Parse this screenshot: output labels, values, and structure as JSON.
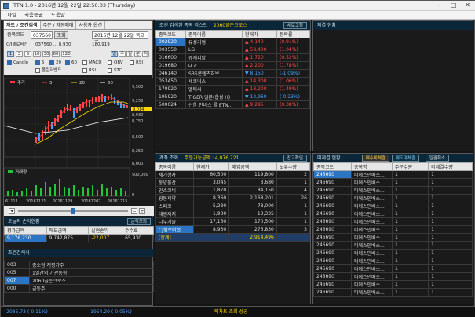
{
  "window": {
    "title": "TTN 1.0 - 2016년 12월 22일 22:50:03 (Thursday)"
  },
  "menu": [
    "파일",
    "키움증권",
    "도움말"
  ],
  "left": {
    "tabs": [
      "차트 / 조건검색",
      "주문 / 자동매매",
      "사용자 옵션"
    ],
    "code_label": "종목코드",
    "code_value": "037560",
    "search_btn": "조회",
    "date_value": "2016년 12월 22일 목요일",
    "info": {
      "name": "C/J헬로비전",
      "price": "037560 ... 8,930",
      "extra": "180,919"
    },
    "period_buttons": [
      "1",
      "3",
      "5",
      "10",
      "30",
      "60",
      "120"
    ],
    "period_right": [
      "일",
      "주",
      "월",
      "분",
      "틱"
    ],
    "indicators_row1": [
      "Candle",
      "5",
      "20",
      "60",
      "MACD",
      "OBV",
      "RSI"
    ],
    "indicators_row2": [
      "볼린저밴드",
      "RSI",
      "STC"
    ],
    "chart": {
      "legend": [
        "주가",
        "5",
        "20",
        "60"
      ],
      "price_labels": [
        "9,500",
        "9,250",
        "9,014",
        "8,930",
        "8,750",
        "8,500",
        "8,250",
        "8,000"
      ],
      "volume_label": "거래량",
      "volume_axis": [
        "500,000",
        "0"
      ],
      "dates": [
        "61111",
        "20161121",
        "20161129",
        "20161207",
        "20161215"
      ]
    },
    "account": {
      "title": "오늘의 손익현황",
      "btn": "손익조회",
      "headers": [
        "평가금액",
        "매도금액",
        "실현손익",
        "수수료"
      ],
      "row": [
        "9,176,230",
        "9,742,875",
        "-22,007",
        "65,930"
      ]
    },
    "condition": {
      "title": "조건검색식",
      "rows": [
        {
          "no": "003",
          "name": "중소형 저평가주"
        },
        {
          "no": "005",
          "name": "1일간의 기관동향"
        },
        {
          "no": "007",
          "name": "2060골든크로스"
        },
        {
          "no": "000",
          "name": "급등주"
        }
      ]
    }
  },
  "cond_list": {
    "title": "조건 검색된 종목 리스트",
    "subtitle": "2060골든크로스",
    "btn": "새로고침",
    "headers": [
      "종목코드",
      "종목이름",
      "현재가",
      "등락률"
    ],
    "rows": [
      {
        "code": "002920",
        "name": "유성기업",
        "price": "▲ 4,140",
        "rate": "(0.91%)",
        "dir": "pos"
      },
      {
        "code": "003550",
        "name": "LG",
        "price": "▲ 58,400",
        "rate": "(1.04%)",
        "dir": "pos"
      },
      {
        "code": "016600",
        "name": "큐캐피탈",
        "price": "▲ 1,720",
        "rate": "(0.52%)",
        "dir": "pos"
      },
      {
        "code": "019680",
        "name": "대교",
        "price": "▲ 2,200",
        "rate": "(1.78%)",
        "dir": "pos"
      },
      {
        "code": "046140",
        "name": "SBS콘텐츠허브",
        "price": "▼ 8,150",
        "rate": "(-1.09%)",
        "dir": "neg"
      },
      {
        "code": "053450",
        "name": "세코닉스",
        "price": "▲ 14,300",
        "rate": "(1.06%)",
        "dir": "pos"
      },
      {
        "code": "170920",
        "name": "엘티씨",
        "price": "▲ 18,200",
        "rate": "(1.49%)",
        "dir": "pos"
      },
      {
        "code": "195920",
        "name": "TIGER 일본(합성 H)",
        "price": "▼ 12,960",
        "rate": "(-0.23%)",
        "dir": "neg"
      },
      {
        "code": "500024",
        "name": "신한 인버스 콜 ETN...",
        "price": "▲ 9,295",
        "rate": "(0.38%)",
        "dir": "pos"
      }
    ]
  },
  "trade_status": {
    "title": "체결 현황"
  },
  "balance": {
    "title": "계좌 조회",
    "subtitle": "주문가능금액 : 4,076,221",
    "btn": "잔고확인",
    "headers": [
      "종목이름",
      "현재가",
      "매입금액",
      "보유수량"
    ],
    "rows": [
      {
        "name": "세기상사",
        "price": "60,500",
        "amount": "119,800",
        "qty": "2"
      },
      {
        "name": "동양물산",
        "price": "3,045",
        "amount": "3,680",
        "qty": "1"
      },
      {
        "name": "인스코비",
        "price": "1,870",
        "amount": "84,150",
        "qty": "4"
      },
      {
        "name": "광동제약",
        "price": "8,360",
        "amount": "2,168,201",
        "qty": "26"
      },
      {
        "name": "스페코",
        "price": "5,230",
        "amount": "78,000",
        "qty": "1"
      },
      {
        "name": "대림제지",
        "price": "1,930",
        "amount": "13,335",
        "qty": "1"
      },
      {
        "name": "다우기술",
        "price": "17,150",
        "amount": "170,500",
        "qty": "1"
      },
      {
        "name": "CJ헬로비전",
        "price": "8,930",
        "amount": "276,830",
        "qty": "3"
      }
    ],
    "sum_label": "[합계]",
    "sum_amount": "2,914,496"
  },
  "unfilled": {
    "title": "미체결 현황",
    "btns": [
      "매수미체결",
      "매도미체결",
      "일괄취소"
    ],
    "headers": [
      "종목코드",
      "종목명",
      "주문수량",
      "미체결수량"
    ],
    "rows": [
      {
        "code": "246690",
        "name": "티에스인베스...",
        "qty": "1",
        "left": "1"
      },
      {
        "code": "246690",
        "name": "티에스인베스...",
        "qty": "1",
        "left": "1"
      },
      {
        "code": "246690",
        "name": "티에스인베스...",
        "qty": "1",
        "left": "1"
      },
      {
        "code": "246690",
        "name": "티에스인베스...",
        "qty": "1",
        "left": "1"
      },
      {
        "code": "246690",
        "name": "티에스인베스...",
        "qty": "1",
        "left": "1"
      },
      {
        "code": "246690",
        "name": "티에스인베스...",
        "qty": "1",
        "left": "1"
      },
      {
        "code": "246690",
        "name": "티에스인베스...",
        "qty": "1",
        "left": "1"
      },
      {
        "code": "246690",
        "name": "티에스인베스...",
        "qty": "1",
        "left": "1"
      },
      {
        "code": "246690",
        "name": "티에스인베스...",
        "qty": "1",
        "left": "1"
      },
      {
        "code": "246690",
        "name": "티에스인베스...",
        "qty": "1",
        "left": "1"
      },
      {
        "code": "246690",
        "name": "티에스인베스...",
        "qty": "1",
        "left": "1"
      },
      {
        "code": "246690",
        "name": "티에스인베스...",
        "qty": "1",
        "left": "1"
      },
      {
        "code": "246690",
        "name": "티에스인베스...",
        "qty": "1",
        "left": "1"
      },
      {
        "code": "246690",
        "name": "티에스인베스...",
        "qty": "1",
        "left": "1"
      },
      {
        "code": "246690",
        "name": "티에스인베스...",
        "qty": "1",
        "left": "1"
      },
      {
        "code": "246690",
        "name": "티에스인베스...",
        "qty": "1",
        "left": "1"
      }
    ]
  },
  "status": {
    "kospi": "-2035.73 (-0.11%)",
    "kosdaq": "-1954.20 (-0.05%)",
    "msg": "틱차트 조회 성공"
  },
  "colors": {
    "accent": "#2c74c4",
    "up": "#ff4a4a",
    "down": "#4aa3ff",
    "header": "#0b2638",
    "sum": "#ffd700"
  }
}
